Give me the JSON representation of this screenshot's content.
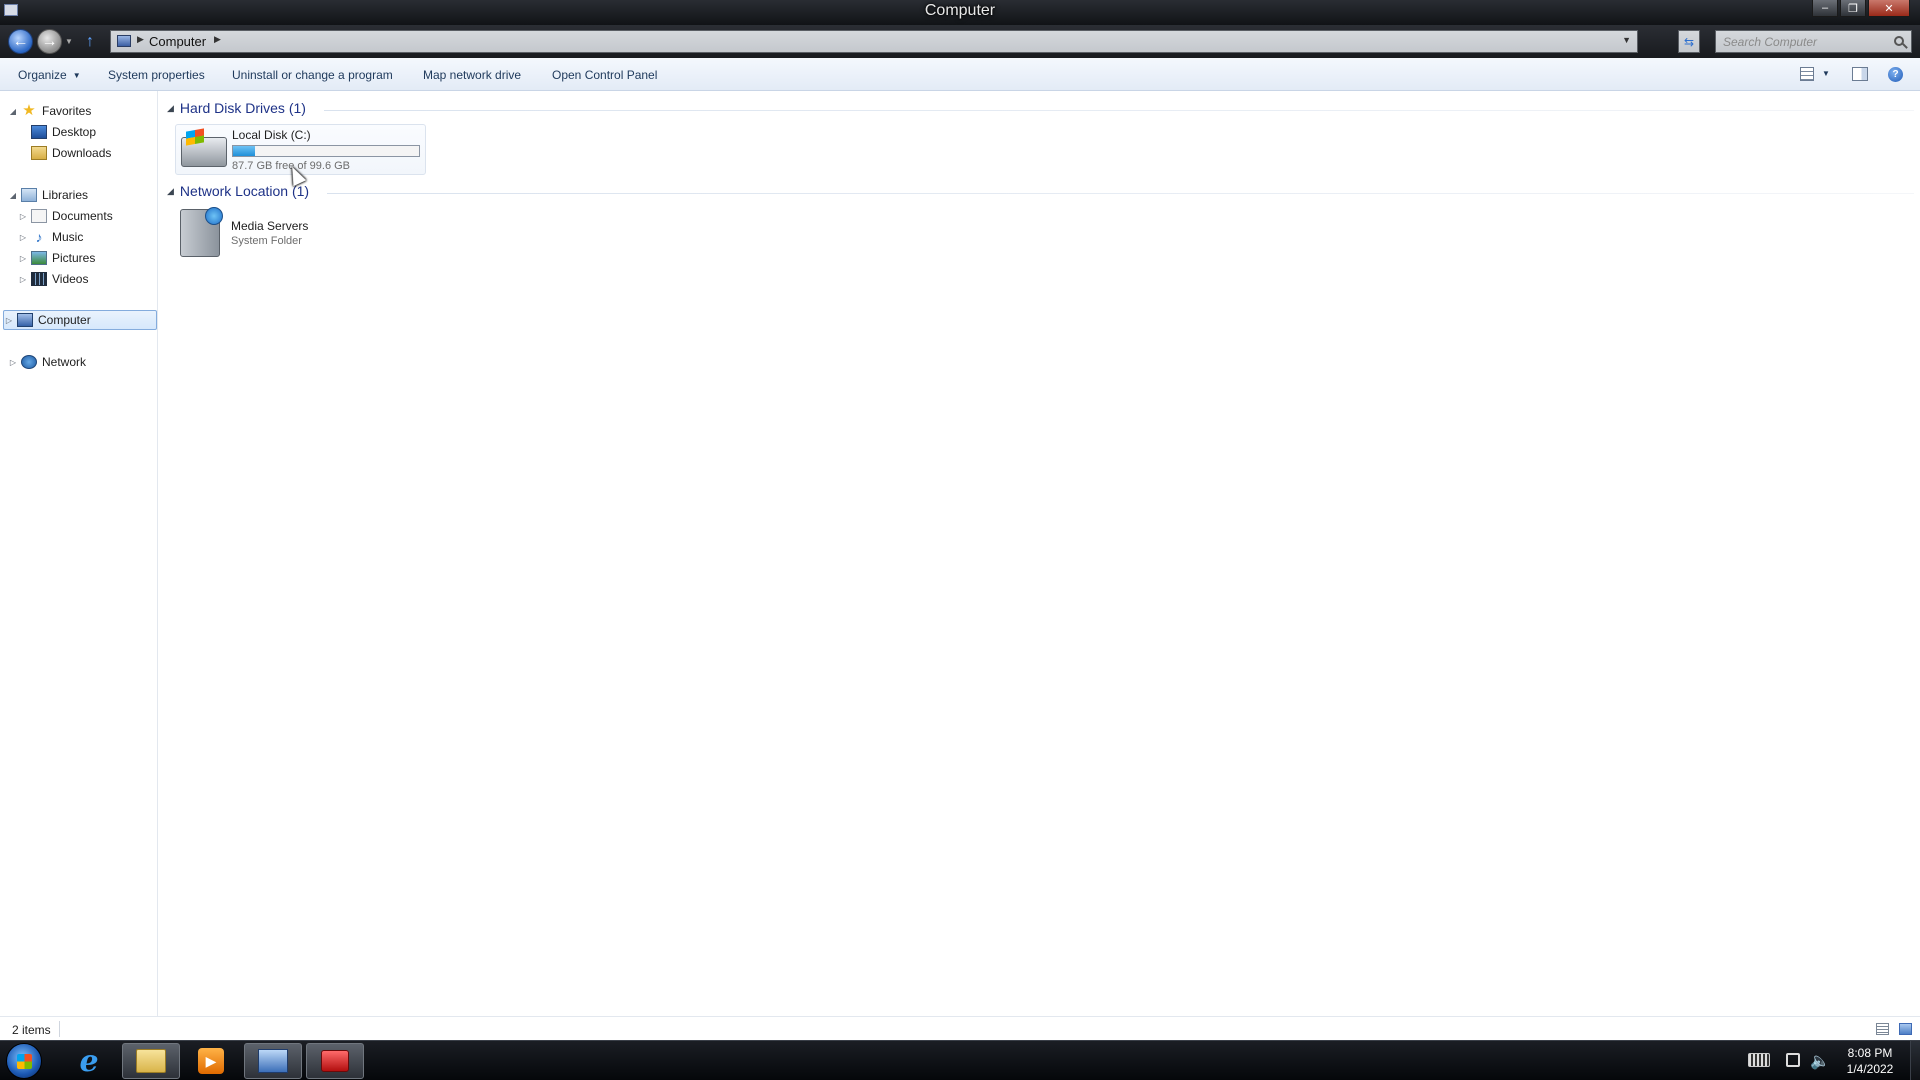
{
  "window": {
    "title": "Computer",
    "controls": {
      "minimize": "–",
      "maximize": "❐",
      "close": "✕"
    }
  },
  "address_bar": {
    "path": "Computer",
    "icon": "computer-icon"
  },
  "search": {
    "placeholder": "Search Computer"
  },
  "command_bar": {
    "organize": "Organize",
    "items": [
      "System properties",
      "Uninstall or change a program",
      "Map network drive",
      "Open Control Panel"
    ]
  },
  "nav_pane": {
    "favorites": {
      "label": "Favorites",
      "children": [
        "Desktop",
        "Downloads"
      ]
    },
    "libraries": {
      "label": "Libraries",
      "children": [
        "Documents",
        "Music",
        "Pictures",
        "Videos"
      ]
    },
    "computer": {
      "label": "Computer",
      "selected": true
    },
    "network": {
      "label": "Network"
    }
  },
  "content": {
    "hard_disk_group": {
      "title": "Hard Disk Drives (1)"
    },
    "drive": {
      "name": "Local Disk (C:)",
      "free_text": "87.7 GB free of 99.6 GB",
      "used_fraction": 0.12
    },
    "network_group": {
      "title": "Network Location (1)"
    },
    "network_item": {
      "name": "Media Servers",
      "type": "System Folder"
    }
  },
  "status_bar": {
    "items_text": "2 items"
  },
  "taskbar": {
    "apps": [
      "start-button",
      "internet-explorer",
      "windows-explorer",
      "media-player",
      "remote-desktop",
      "toolbox-app"
    ],
    "clock": {
      "time": "8:08 PM",
      "date": "1/4/2022"
    }
  }
}
